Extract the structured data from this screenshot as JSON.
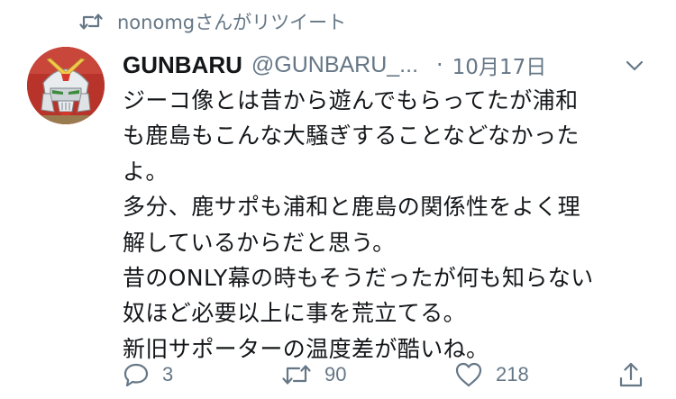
{
  "retweet_context": {
    "icon": "retweet-icon",
    "text": "nonomgさんがリツイート"
  },
  "tweet": {
    "author": {
      "display_name": "GUNBARU",
      "handle": "@GUNBARU_...",
      "avatar": "robot-helmet-avatar"
    },
    "separator": "·",
    "date": "10月17日",
    "menu_icon": "chevron-down-icon",
    "body_lines": [
      "ジーコ像とは昔から遊んでもらってたが浦和",
      "も鹿島もこんな大騒ぎすることなどなかった",
      "よ。",
      "多分、鹿サポも浦和と鹿島の関係性をよく理",
      "解しているからだと思う。",
      "昔のONLY幕の時もそうだったが何も知らない",
      "奴ほど必要以上に事を荒立てる。",
      "新旧サポーターの温度差が酷いね。"
    ],
    "actions": {
      "reply": {
        "icon": "reply-icon",
        "count": "3"
      },
      "retweet": {
        "icon": "retweet-icon",
        "count": "90"
      },
      "like": {
        "icon": "heart-icon",
        "count": "218"
      },
      "share": {
        "icon": "share-icon"
      }
    }
  },
  "colors": {
    "text_primary": "#14171a",
    "text_secondary": "#657786",
    "background": "#ffffff"
  }
}
